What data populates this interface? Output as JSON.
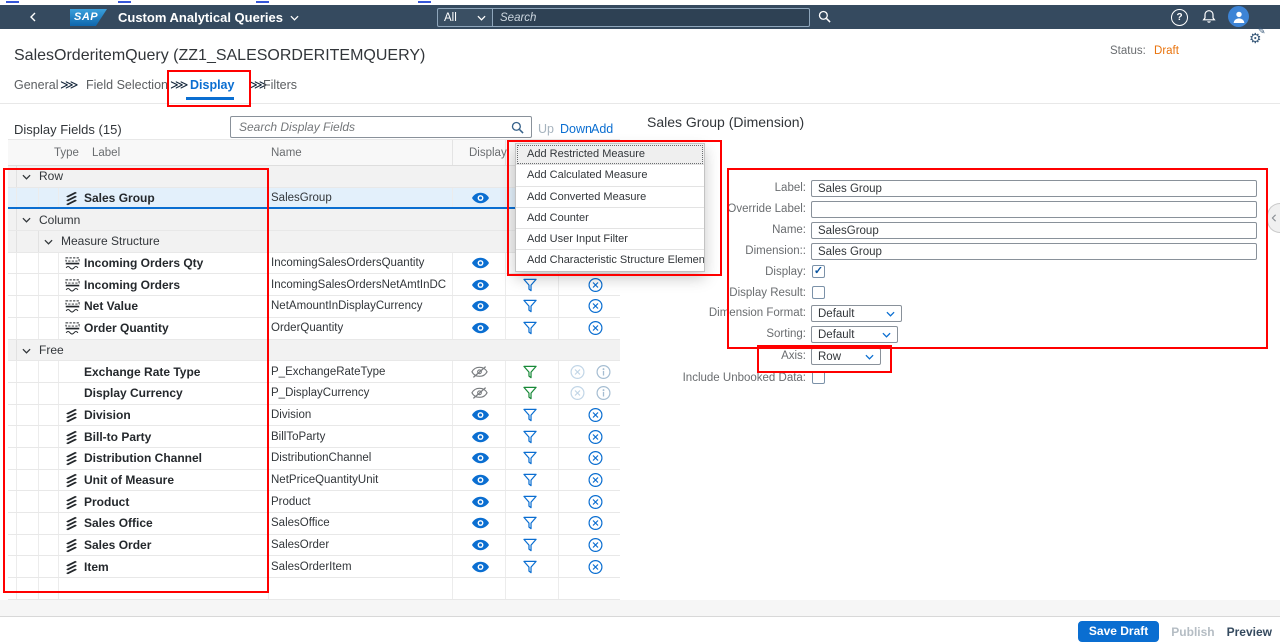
{
  "shell": {
    "logo": "SAP",
    "title": "Custom Analytical Queries",
    "search_scope": "All",
    "search_placeholder": "Search",
    "icons": [
      "back-icon",
      "chevron-down-icon",
      "search-icon",
      "help-icon",
      "bell-icon",
      "avatar-icon"
    ]
  },
  "page": {
    "title": "SalesOrderitemQuery (ZZ1_SALESORDERITEMQUERY)",
    "status_label": "Status:",
    "status_value": "Draft",
    "adapt_icon": "adapt-ui-gear-pencil-icon"
  },
  "tabs": [
    {
      "label": "General",
      "selected": false
    },
    {
      "label": "Field Selection",
      "selected": false
    },
    {
      "label": "Display",
      "selected": true
    },
    {
      "label": "Filters",
      "selected": false
    }
  ],
  "toolbar": {
    "title": "Display Fields (15)",
    "search_placeholder": "Search Display Fields",
    "up": "Up",
    "down": "Down",
    "add": "Add"
  },
  "table": {
    "headers": {
      "type": "Type",
      "label": "Label",
      "name": "Name",
      "display": "Display",
      "obscured_fragment": "s"
    },
    "rows": [
      {
        "kind": "group",
        "level": 0,
        "label": "Row",
        "icon": "chevron-down-icon"
      },
      {
        "kind": "item",
        "selected": true,
        "type_icon": "dimension-icon",
        "label": "Sales Group",
        "name": "SalesGroup",
        "visibility_icon": "eye-icon",
        "filter_icon": "filter-icon",
        "action_icon": "decline-icon"
      },
      {
        "kind": "group",
        "level": 0,
        "label": "Column",
        "icon": "chevron-down-icon"
      },
      {
        "kind": "group",
        "level": 1,
        "label": "Measure Structure",
        "icon": "chevron-down-icon"
      },
      {
        "kind": "item",
        "type_icon": "measure-icon",
        "label": "Incoming Orders Qty",
        "name": "IncomingSalesOrdersQuantity",
        "visibility_icon": "eye-icon",
        "filter_icon": "filter-icon",
        "action_icon": "decline-icon"
      },
      {
        "kind": "item",
        "type_icon": "measure-icon",
        "label": "Incoming Orders",
        "name": "IncomingSalesOrdersNetAmtInDC",
        "visibility_icon": "eye-icon",
        "filter_icon": "filter-icon",
        "action_icon": "decline-icon"
      },
      {
        "kind": "item",
        "type_icon": "measure-icon",
        "label": "Net Value",
        "name": "NetAmountInDisplayCurrency",
        "visibility_icon": "eye-icon",
        "filter_icon": "filter-icon",
        "action_icon": "decline-icon"
      },
      {
        "kind": "item",
        "type_icon": "measure-icon",
        "label": "Order Quantity",
        "name": "OrderQuantity",
        "visibility_icon": "eye-icon",
        "filter_icon": "filter-icon",
        "action_icon": "decline-icon"
      },
      {
        "kind": "group",
        "level": 0,
        "label": "Free",
        "icon": "chevron-down-icon"
      },
      {
        "kind": "item",
        "type_icon": null,
        "label": "Exchange Rate Type",
        "name": "P_ExchangeRateType",
        "visibility_icon": "eye-off-icon",
        "filter_icon": "filter-icon-green",
        "action_icons": [
          "decline-icon-disabled",
          "info-icon"
        ]
      },
      {
        "kind": "item",
        "type_icon": null,
        "label": "Display Currency",
        "name": "P_DisplayCurrency",
        "visibility_icon": "eye-off-icon",
        "filter_icon": "filter-icon-green",
        "action_icons": [
          "decline-icon-disabled",
          "info-icon"
        ]
      },
      {
        "kind": "item",
        "type_icon": "dimension-icon",
        "label": "Division",
        "name": "Division",
        "visibility_icon": "eye-icon",
        "filter_icon": "filter-icon",
        "action_icon": "decline-icon"
      },
      {
        "kind": "item",
        "type_icon": "dimension-icon",
        "label": "Bill-to Party",
        "name": "BillToParty",
        "visibility_icon": "eye-icon",
        "filter_icon": "filter-icon",
        "action_icon": "decline-icon"
      },
      {
        "kind": "item",
        "type_icon": "dimension-icon",
        "label": "Distribution Channel",
        "name": "DistributionChannel",
        "visibility_icon": "eye-icon",
        "filter_icon": "filter-icon",
        "action_icon": "decline-icon"
      },
      {
        "kind": "item",
        "type_icon": "dimension-icon",
        "label": "Unit of Measure",
        "name": "NetPriceQuantityUnit",
        "visibility_icon": "eye-icon",
        "filter_icon": "filter-icon",
        "action_icon": "decline-icon"
      },
      {
        "kind": "item",
        "type_icon": "dimension-icon",
        "label": "Product",
        "name": "Product",
        "visibility_icon": "eye-icon",
        "filter_icon": "filter-icon",
        "action_icon": "decline-icon"
      },
      {
        "kind": "item",
        "type_icon": "dimension-icon",
        "label": "Sales Office",
        "name": "SalesOffice",
        "visibility_icon": "eye-icon",
        "filter_icon": "filter-icon",
        "action_icon": "decline-icon"
      },
      {
        "kind": "item",
        "type_icon": "dimension-icon",
        "label": "Sales Order",
        "name": "SalesOrder",
        "visibility_icon": "eye-icon",
        "filter_icon": "filter-icon",
        "action_icon": "decline-icon"
      },
      {
        "kind": "item",
        "type_icon": "dimension-icon",
        "label": "Item",
        "name": "SalesOrderItem",
        "visibility_icon": "eye-icon",
        "filter_icon": "filter-icon",
        "action_icon": "decline-icon"
      },
      {
        "kind": "empty"
      }
    ]
  },
  "add_menu": {
    "items": [
      "Add Restricted Measure",
      "Add Calculated Measure",
      "Add Converted Measure",
      "Add Counter",
      "Add User Input Filter",
      "Add Characteristic Structure Element"
    ]
  },
  "panel": {
    "title": "Sales Group (Dimension)",
    "fields": [
      {
        "label": "Label:",
        "control": "input",
        "value": "Sales Group"
      },
      {
        "label": "Override Label:",
        "control": "input",
        "value": ""
      },
      {
        "label": "Name:",
        "control": "input",
        "value": "SalesGroup"
      },
      {
        "label": "Dimension::",
        "control": "input",
        "value": "Sales Group"
      },
      {
        "label": "Display:",
        "control": "checkbox",
        "checked": true
      },
      {
        "label": "Display Result:",
        "control": "checkbox",
        "checked": false
      },
      {
        "label": "Dimension Format:",
        "control": "select",
        "value": "Default"
      },
      {
        "label": "Sorting:",
        "control": "select",
        "value": "Default"
      },
      {
        "label": "Axis:",
        "control": "select",
        "value": "Row"
      },
      {
        "label": "Include Unbooked Data:",
        "control": "checkbox",
        "checked": false
      }
    ]
  },
  "footer": {
    "save_draft": "Save Draft",
    "publish": "Publish",
    "preview": "Preview"
  },
  "colors": {
    "accent_blue": "#0a6ed1",
    "shell_bg": "#354a5f",
    "status_draft_orange": "#e9730c",
    "annotation_red": "#ff0000",
    "filter_green": "#188938",
    "selected_row_bg": "#e3f0fb"
  }
}
